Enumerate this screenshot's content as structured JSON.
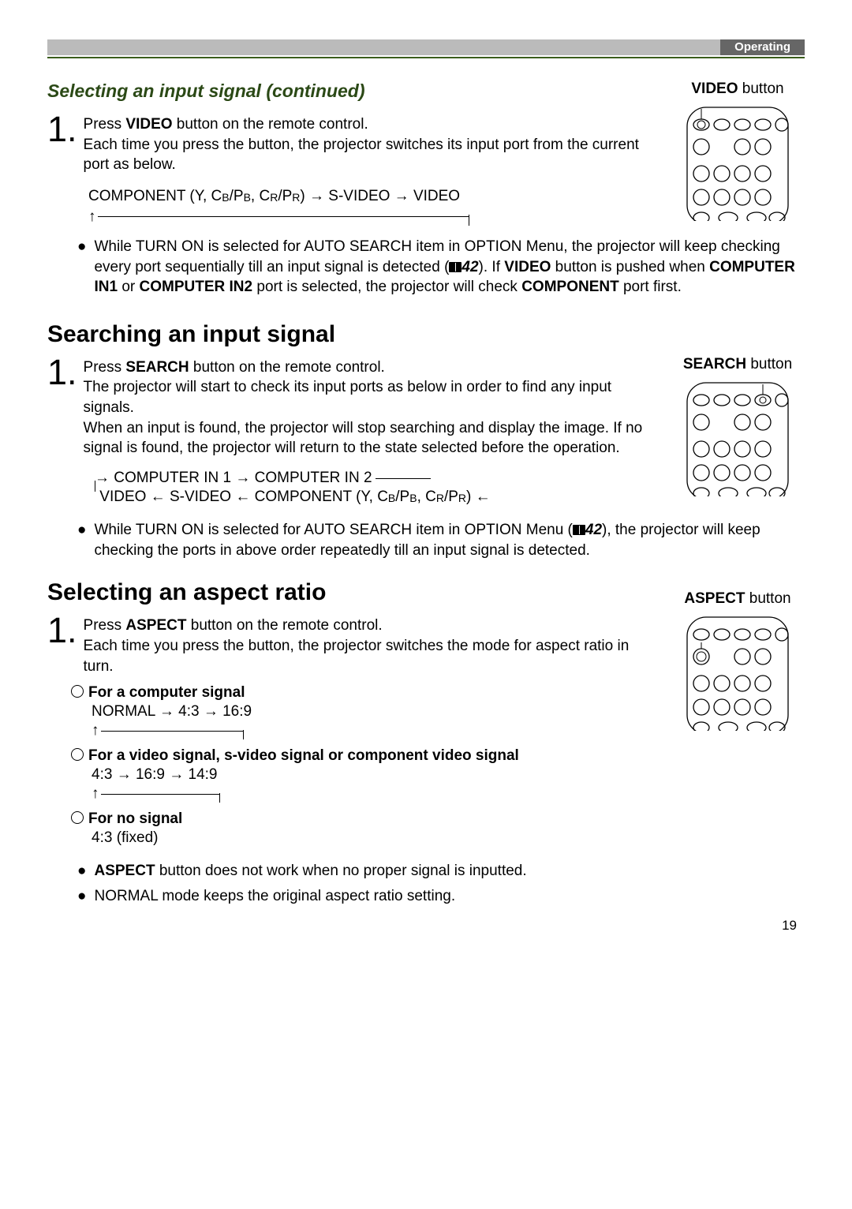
{
  "header": {
    "tab": "Operating"
  },
  "sec1": {
    "title": "Selecting an input signal (continued)",
    "side_label_strong": "VIDEO",
    "side_label_rest": " button",
    "step1_a": "Press ",
    "step1_b": "VIDEO",
    "step1_c": " button on the remote control.",
    "step1_d": "Each time you press the button, the projector switches its input port from the current port as below.",
    "chain": "COMPONENT (Y, C",
    "chain_b": "B",
    "chain_c": "/P",
    "chain_d": "B",
    "chain_e": ", C",
    "chain_f": "R",
    "chain_g": "/P",
    "chain_h": "R",
    "chain_i": ") → S-VIDEO → VIDEO",
    "bullet_a": "While TURN ON is selected for AUTO SEARCH item in OPTION Menu, the projector will keep checking every port sequentially till an input signal is detected (",
    "bullet_page": "42",
    "bullet_b": "). If ",
    "bullet_c": "VIDEO",
    "bullet_d": " button is pushed when ",
    "bullet_e": "COMPUTER IN1",
    "bullet_f": " or ",
    "bullet_g": "COMPUTER IN2",
    "bullet_h": " port is selected, the projector will check ",
    "bullet_i": "COMPONENT",
    "bullet_j": " port first."
  },
  "sec2": {
    "title": "Searching an input signal",
    "side_label_strong": "SEARCH",
    "side_label_rest": " button",
    "step1_a": "Press ",
    "step1_b": "SEARCH",
    "step1_c": " button on the remote control.",
    "step1_d": "The projector will start to check its input ports as below in order to find any input signals.",
    "step1_e": "When an input is found, the projector will stop searching and display the image. If no signal is found, the projector will return to the state selected before the operation.",
    "row1_a": "→ COMPUTER IN 1 → COMPUTER IN 2",
    "row2_a": "VIDEO ← S-VIDEO ← COMPONENT (Y, C",
    "row2_b": "B",
    "row2_c": "/P",
    "row2_d": "B",
    "row2_e": ", C",
    "row2_f": "R",
    "row2_g": "/P",
    "row2_h": "R",
    "row2_i": ")  ←",
    "bullet_a": "While TURN ON is selected for AUTO SEARCH item in OPTION Menu (",
    "bullet_page": "42",
    "bullet_b": "), the projector will keep checking the ports in above order repeatedly till an input signal is detected."
  },
  "sec3": {
    "title": "Selecting an aspect ratio",
    "side_label_strong": "ASPECT",
    "side_label_rest": " button",
    "step1_a": "Press ",
    "step1_b": "ASPECT",
    "step1_c": " button on the remote control.",
    "step1_d": "Each time you press the button, the projector switches the mode for aspect ratio in turn.",
    "sub1": "For a computer signal",
    "sub1_chain": "NORMAL → 4:3 → 16:9",
    "sub2": "For a video signal, s-video signal or component video signal",
    "sub2_chain": "4:3 → 16:9 → 14:9",
    "sub3": "For no signal",
    "sub3_chain": "4:3 (fixed)",
    "bullet_a": "ASPECT",
    "bullet_b": " button does not work when no proper signal is inputted.",
    "bullet_c": "NORMAL mode keeps the original aspect ratio setting."
  },
  "page_number": "19"
}
